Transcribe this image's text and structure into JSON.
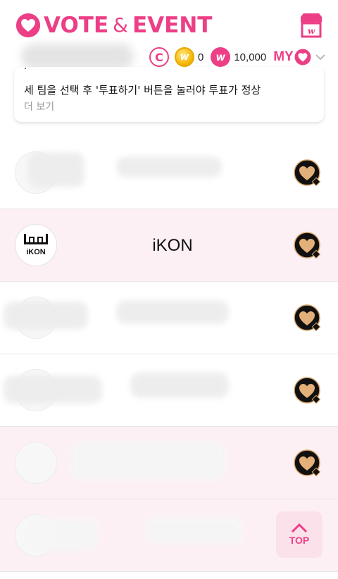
{
  "header": {
    "title_left": "VOTE",
    "title_amp": "&",
    "title_right": "EVENT",
    "shop_icon": "store-icon",
    "accent_color": "#ec3f86"
  },
  "wallet": {
    "gold_amount": "0",
    "heart_amount": "10,000",
    "my_label": "MY"
  },
  "notice": {
    "text": "세 팀을 선택 후 '투표하기' 버튼을 눌러야 투표가 정상",
    "more_label": "더 보기"
  },
  "list": {
    "rows": [
      {
        "name": "",
        "highlighted": false
      },
      {
        "name": "iKON",
        "highlighted": true
      },
      {
        "name": "",
        "highlighted": false
      },
      {
        "name": "",
        "highlighted": false
      },
      {
        "name": "",
        "highlighted": true
      },
      {
        "name": "",
        "highlighted": true
      }
    ],
    "vote_icon": "gold-heart-vote-icon"
  },
  "top_button": {
    "label": "TOP"
  }
}
